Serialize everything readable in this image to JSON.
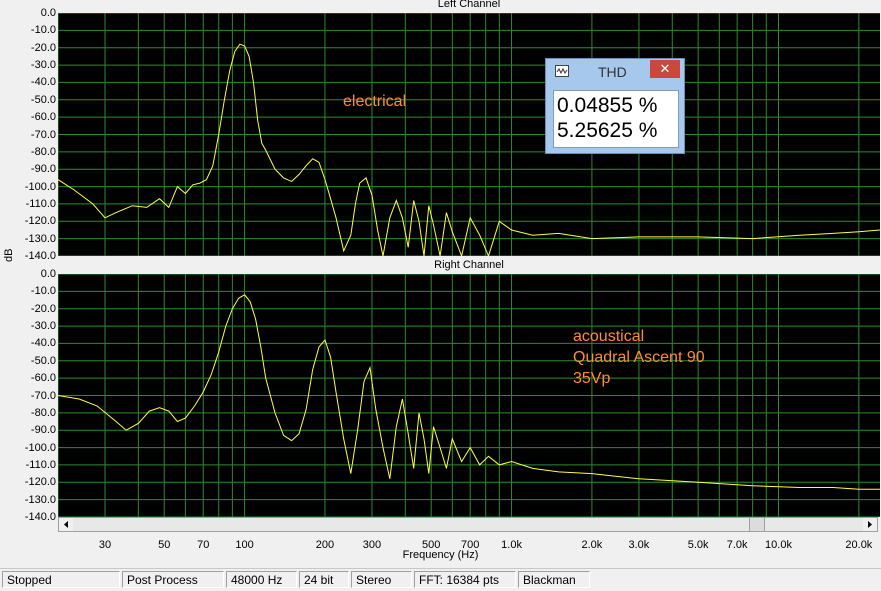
{
  "plots": {
    "left": {
      "title": "Left Channel",
      "annotation": "electrical"
    },
    "right": {
      "title": "Right Channel",
      "annotations": [
        "acoustical",
        "Quadral Ascent 90",
        "35Vp"
      ]
    }
  },
  "y_axis": {
    "unit": "dB",
    "ticks": [
      "0.0",
      "-10.0",
      "-20.0",
      "-30.0",
      "-40.0",
      "-50.0",
      "-60.0",
      "-70.0",
      "-80.0",
      "-90.0",
      "-100.0",
      "-110.0",
      "-120.0",
      "-130.0",
      "-140.0"
    ]
  },
  "x_axis": {
    "title": "Frequency (Hz)",
    "ticks": [
      {
        "label": "30",
        "f": 30
      },
      {
        "label": "50",
        "f": 50
      },
      {
        "label": "70",
        "f": 70
      },
      {
        "label": "100",
        "f": 100
      },
      {
        "label": "200",
        "f": 200
      },
      {
        "label": "300",
        "f": 300
      },
      {
        "label": "500",
        "f": 500
      },
      {
        "label": "700",
        "f": 700
      },
      {
        "label": "1.0k",
        "f": 1000
      },
      {
        "label": "2.0k",
        "f": 2000
      },
      {
        "label": "3.0k",
        "f": 3000
      },
      {
        "label": "5.0k",
        "f": 5000
      },
      {
        "label": "7.0k",
        "f": 7000
      },
      {
        "label": "10.0k",
        "f": 10000
      },
      {
        "label": "20.0k",
        "f": 20000
      }
    ]
  },
  "thd_window": {
    "title": "THD",
    "close_label": "✕",
    "values": [
      "0.04855 %",
      "5.25625 %"
    ]
  },
  "status_bar": {
    "fields": [
      "Stopped",
      "Post Process",
      "48000 Hz",
      "24 bit",
      "Stereo",
      "FFT: 16384 pts",
      "Blackman"
    ]
  },
  "colors": {
    "plot_bg": "#000000",
    "grid": "#2e8b2e",
    "trace": "#ffff40",
    "annotation": "#ff8c3a"
  },
  "chart_data": [
    {
      "type": "line",
      "title": "Left Channel",
      "xlabel": "Frequency (Hz)",
      "ylabel": "dB",
      "x_scale": "log",
      "xlim": [
        20,
        24000
      ],
      "ylim": [
        -140,
        0
      ],
      "grid": true,
      "series": [
        {
          "x": [
            20,
            23,
            27,
            30,
            33,
            38,
            43,
            48,
            52,
            56,
            60,
            64,
            68,
            72,
            76,
            80,
            84,
            88,
            92,
            96,
            100,
            104,
            108,
            112,
            116,
            120,
            130,
            140,
            150,
            160,
            170,
            180,
            190,
            200,
            210,
            220,
            235,
            250,
            260,
            270,
            285,
            300,
            315,
            330,
            350,
            370,
            390,
            410,
            430,
            450,
            470,
            490,
            510,
            540,
            570,
            600,
            650,
            700,
            760,
            820,
            900,
            1000,
            1200,
            1500,
            2000,
            3000,
            5000,
            8000,
            12000,
            16000,
            20000,
            24000
          ],
          "y": [
            -96,
            -102,
            -110,
            -118,
            -115,
            -111,
            -112,
            -107,
            -112,
            -100,
            -104,
            -99,
            -98,
            -96,
            -88,
            -70,
            -50,
            -33,
            -22,
            -18,
            -19,
            -25,
            -40,
            -62,
            -75,
            -79,
            -90,
            -95,
            -97,
            -93,
            -88,
            -84,
            -86,
            -96,
            -107,
            -118,
            -137,
            -128,
            -110,
            -98,
            -95,
            -105,
            -125,
            -140,
            -118,
            -108,
            -118,
            -135,
            -108,
            -120,
            -140,
            -111,
            -122,
            -140,
            -115,
            -126,
            -140,
            -118,
            -128,
            -140,
            -120,
            -125,
            -128,
            -127,
            -130,
            -129,
            -129,
            -130,
            -128,
            -127,
            -126,
            -125
          ]
        }
      ]
    },
    {
      "type": "line",
      "title": "Right Channel",
      "xlabel": "Frequency (Hz)",
      "ylabel": "dB",
      "x_scale": "log",
      "xlim": [
        20,
        24000
      ],
      "ylim": [
        -140,
        0
      ],
      "grid": true,
      "series": [
        {
          "x": [
            20,
            24,
            28,
            33,
            36,
            40,
            44,
            48,
            52,
            56,
            60,
            65,
            70,
            75,
            80,
            85,
            90,
            95,
            100,
            105,
            110,
            115,
            120,
            130,
            140,
            150,
            160,
            170,
            180,
            190,
            200,
            210,
            220,
            235,
            250,
            265,
            280,
            295,
            310,
            330,
            350,
            370,
            390,
            410,
            430,
            450,
            470,
            490,
            510,
            540,
            570,
            600,
            650,
            700,
            760,
            820,
            900,
            1000,
            1200,
            1500,
            2000,
            3000,
            5000,
            8000,
            12000,
            16000,
            20000,
            24000
          ],
          "y": [
            -70,
            -72,
            -76,
            -85,
            -90,
            -86,
            -79,
            -77,
            -79,
            -85,
            -83,
            -76,
            -68,
            -58,
            -45,
            -30,
            -20,
            -14,
            -12,
            -16,
            -26,
            -42,
            -60,
            -80,
            -93,
            -96,
            -92,
            -78,
            -55,
            -42,
            -38,
            -48,
            -68,
            -95,
            -115,
            -90,
            -62,
            -54,
            -78,
            -100,
            -118,
            -88,
            -72,
            -92,
            -112,
            -80,
            -95,
            -115,
            -88,
            -100,
            -112,
            -95,
            -108,
            -100,
            -110,
            -105,
            -110,
            -108,
            -112,
            -114,
            -115,
            -118,
            -120,
            -122,
            -123,
            -123,
            -124,
            -124
          ]
        }
      ]
    }
  ]
}
